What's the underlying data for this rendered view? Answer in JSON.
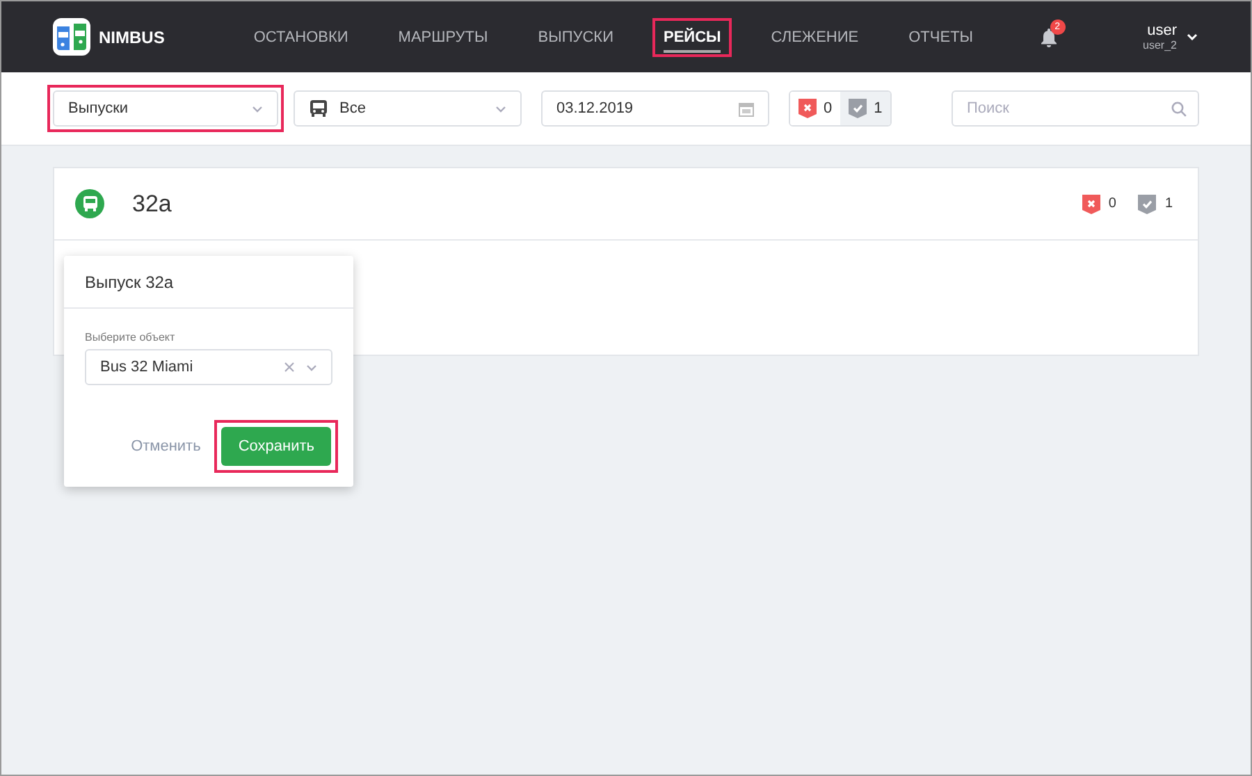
{
  "app": {
    "name": "NIMBUS"
  },
  "nav": [
    {
      "label": "ОСТАНОВКИ",
      "selected": false,
      "highlighted": false
    },
    {
      "label": "МАРШРУТЫ",
      "selected": false,
      "highlighted": false
    },
    {
      "label": "ВЫПУСКИ",
      "selected": false,
      "highlighted": false
    },
    {
      "label": "РЕЙСЫ",
      "selected": true,
      "highlighted": true
    },
    {
      "label": "СЛЕЖЕНИЕ",
      "selected": false,
      "highlighted": false
    },
    {
      "label": "ОТЧЕТЫ",
      "selected": false,
      "highlighted": false
    }
  ],
  "notifications": {
    "count": "2"
  },
  "user": {
    "name": "user",
    "login": "user_2"
  },
  "filters": {
    "mode": {
      "value": "Выпуски",
      "highlighted": true
    },
    "vehicle_type": {
      "value": "Все"
    },
    "date": {
      "value": "03.12.2019"
    },
    "counters": [
      {
        "kind": "error",
        "count": "0",
        "selected": false
      },
      {
        "kind": "ok",
        "count": "1",
        "selected": true
      }
    ],
    "search": {
      "placeholder": "Поиск"
    }
  },
  "route": {
    "name": "32a",
    "counters": [
      {
        "kind": "error",
        "count": "0"
      },
      {
        "kind": "ok",
        "count": "1"
      }
    ]
  },
  "dialog": {
    "title": "Выпуск 32а",
    "field": {
      "label": "Выберите объект",
      "value": "Bus 32 Miami"
    },
    "cancel": "Отменить",
    "save": {
      "label": "Сохранить",
      "highlighted": true
    }
  }
}
